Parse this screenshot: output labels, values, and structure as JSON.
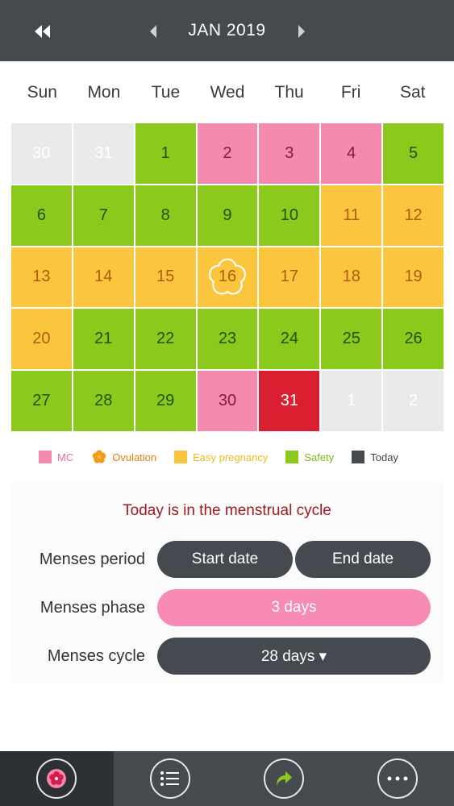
{
  "header": {
    "title": "JAN 2019"
  },
  "weekdays": [
    "Sun",
    "Mon",
    "Tue",
    "Wed",
    "Thu",
    "Fri",
    "Sat"
  ],
  "calendar": {
    "days": [
      {
        "label": "30",
        "status": "out"
      },
      {
        "label": "31",
        "status": "out"
      },
      {
        "label": "1",
        "status": "safety"
      },
      {
        "label": "2",
        "status": "mc"
      },
      {
        "label": "3",
        "status": "mc"
      },
      {
        "label": "4",
        "status": "mc"
      },
      {
        "label": "5",
        "status": "safety"
      },
      {
        "label": "6",
        "status": "safety"
      },
      {
        "label": "7",
        "status": "safety"
      },
      {
        "label": "8",
        "status": "safety"
      },
      {
        "label": "9",
        "status": "safety"
      },
      {
        "label": "10",
        "status": "safety"
      },
      {
        "label": "11",
        "status": "easy"
      },
      {
        "label": "12",
        "status": "easy"
      },
      {
        "label": "13",
        "status": "easy"
      },
      {
        "label": "14",
        "status": "easy"
      },
      {
        "label": "15",
        "status": "easy"
      },
      {
        "label": "16",
        "status": "easy",
        "ovulation": true
      },
      {
        "label": "17",
        "status": "easy"
      },
      {
        "label": "18",
        "status": "easy"
      },
      {
        "label": "19",
        "status": "easy"
      },
      {
        "label": "20",
        "status": "easy"
      },
      {
        "label": "21",
        "status": "safety"
      },
      {
        "label": "22",
        "status": "safety"
      },
      {
        "label": "23",
        "status": "safety"
      },
      {
        "label": "24",
        "status": "safety"
      },
      {
        "label": "25",
        "status": "safety"
      },
      {
        "label": "26",
        "status": "safety"
      },
      {
        "label": "27",
        "status": "safety"
      },
      {
        "label": "28",
        "status": "safety"
      },
      {
        "label": "29",
        "status": "safety"
      },
      {
        "label": "30",
        "status": "mc"
      },
      {
        "label": "31",
        "status": "today"
      },
      {
        "label": "1",
        "status": "out"
      },
      {
        "label": "2",
        "status": "out"
      }
    ]
  },
  "legend": {
    "mc": "MC",
    "ovulation": "Ovulation",
    "easy": "Easy pregnancy",
    "safety": "Safety",
    "today": "Today"
  },
  "colors": {
    "mc": "#f58ab1",
    "safety": "#8cc91d",
    "easy": "#fbc63e",
    "today": "#da1f31",
    "ovulation": "#e38013",
    "header": "#454a4f"
  },
  "info": {
    "status": "Today is in the menstrual cycle",
    "period_label": "Menses period",
    "start_date": "Start date",
    "end_date": "End date",
    "phase_label": "Menses phase",
    "phase_value": "3 days",
    "cycle_label": "Menses cycle",
    "cycle_value": "28 days ▾"
  },
  "tabbar": {
    "icons": [
      "flower-icon",
      "list-icon",
      "share-arrow-icon",
      "more-icon"
    ]
  }
}
